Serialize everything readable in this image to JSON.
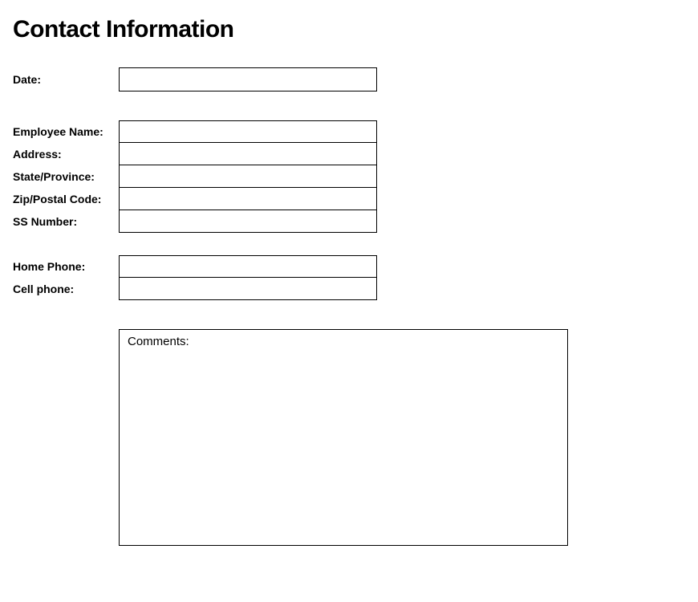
{
  "heading": "Contact Information",
  "fields": {
    "date": {
      "label": "Date:",
      "value": ""
    },
    "employee_name": {
      "label": "Employee Name:",
      "value": ""
    },
    "address": {
      "label": "Address:",
      "value": ""
    },
    "state_province": {
      "label": "State/Province:",
      "value": ""
    },
    "zip_postal": {
      "label": "Zip/Postal Code:",
      "value": ""
    },
    "ss_number": {
      "label": "SS Number:",
      "value": ""
    },
    "home_phone": {
      "label": "Home Phone:",
      "value": ""
    },
    "cell_phone": {
      "label": "Cell phone:",
      "value": ""
    },
    "comments": {
      "label": "Comments:",
      "value": ""
    }
  }
}
